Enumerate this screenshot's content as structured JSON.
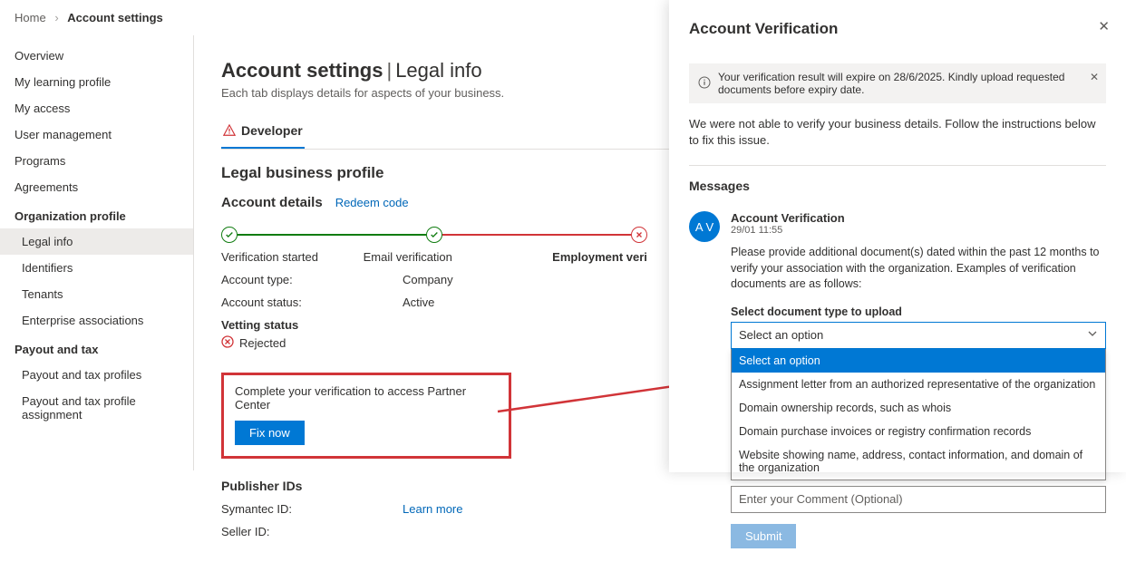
{
  "breadcrumb": {
    "home": "Home",
    "current": "Account settings"
  },
  "sidebar": {
    "items": [
      "Overview",
      "My learning profile",
      "My access",
      "User management",
      "Programs",
      "Agreements"
    ],
    "org_heading": "Organization profile",
    "org_items": [
      "Legal info",
      "Identifiers",
      "Tenants",
      "Enterprise associations"
    ],
    "tax_heading": "Payout and tax",
    "tax_items": [
      "Payout and tax profiles",
      "Payout and tax profile assignment"
    ]
  },
  "main": {
    "title_a": "Account settings",
    "title_b": "Legal info",
    "desc": "Each tab displays details for aspects of your business.",
    "tab_dev": "Developer",
    "h1": "Legal business profile",
    "h2": "Account details",
    "redeem": "Redeem code",
    "steps": [
      "Verification started",
      "Email verification",
      "Employment veri"
    ],
    "kv": [
      {
        "k": "Account type:",
        "v": "Company"
      },
      {
        "k": "Account status:",
        "v": "Active"
      }
    ],
    "vetting_label": "Vetting status",
    "vetting_value": "Rejected",
    "cta_text": "Complete your verification to access Partner Center",
    "cta_btn": "Fix now",
    "pub_h": "Publisher IDs",
    "sym_label": "Symantec ID:",
    "learn_more": "Learn more",
    "seller_label": "Seller ID:"
  },
  "panel": {
    "title": "Account Verification",
    "banner": "Your verification result will expire on 28/6/2025. Kindly upload requested documents before expiry date.",
    "text1": "We were not able to verify your business details. Follow the instructions below to fix this issue.",
    "msgs_h": "Messages",
    "avatar": "A V",
    "msg_title": "Account Verification",
    "msg_date": "29/01 11:55",
    "msg_text": "Please provide additional document(s) dated within the past 12 months to verify your association with the organization. Examples of verification documents are as follows:",
    "select_label": "Select document type to upload",
    "select_value": "Select an option",
    "options": [
      "Select an option",
      "Assignment letter from an authorized representative of the organization",
      "Domain ownership records, such as whois",
      "Domain purchase invoices or registry confirmation records",
      "Website showing name, address, contact information, and domain of the organization"
    ],
    "comment_ph": "Enter your Comment (Optional)",
    "submit": "Submit"
  }
}
